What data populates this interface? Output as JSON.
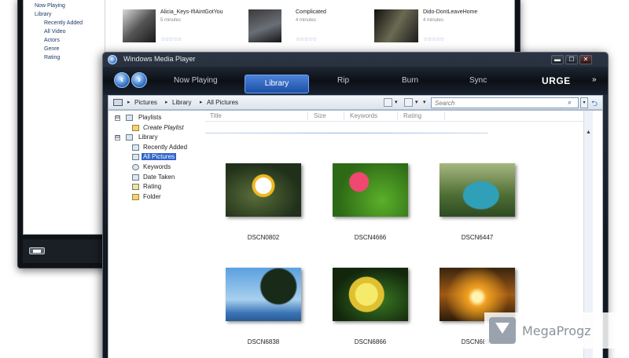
{
  "back_window": {
    "nav": [
      "Now Playing",
      "Library",
      "Recently Added",
      "All Video",
      "Actors",
      "Genre",
      "Rating"
    ],
    "videos": [
      {
        "title": "Alicia_Keys-IfIAintGotYou",
        "duration": "5 minutes",
        "stars": "☆☆☆☆☆"
      },
      {
        "title": "Complicated",
        "duration": "4 minutes",
        "stars": "☆☆☆☆☆"
      },
      {
        "title": "Dido-DontLeaveHome",
        "duration": "4 minutes",
        "stars": "☆☆☆☆☆"
      }
    ]
  },
  "window": {
    "title": "Windows Media Player",
    "controls": {
      "minimize": "▬",
      "maximize": "☐",
      "close": "✕"
    }
  },
  "toolbar": {
    "back": "‹",
    "forward": "›",
    "tabs": [
      "Now Playing",
      "Library",
      "Rip",
      "Burn",
      "Sync"
    ],
    "active_tab": "Library",
    "brand": "URGE",
    "more": "»"
  },
  "address": {
    "crumbs": [
      "Pictures",
      "Library",
      "All Pictures"
    ],
    "search_placeholder": "Search"
  },
  "tree": {
    "playlists": "Playlists",
    "create_playlist": "Create Playlist",
    "library": "Library",
    "items": [
      "Recently Added",
      "All Pictures",
      "Keywords",
      "Date Taken",
      "Rating",
      "Folder"
    ],
    "selected": "All Pictures"
  },
  "columns": [
    "Title",
    "Size",
    "Keywords",
    "Rating"
  ],
  "pictures": [
    {
      "name": "DSCN0802"
    },
    {
      "name": "DSCN4666"
    },
    {
      "name": "DSCN6447"
    },
    {
      "name": "DSCN6838"
    },
    {
      "name": "DSCN6866"
    },
    {
      "name": "DSCN6891"
    }
  ],
  "watermark": "MegaProgz",
  "colors": {
    "accent": "#2f63c7",
    "chrome": "#121820"
  }
}
